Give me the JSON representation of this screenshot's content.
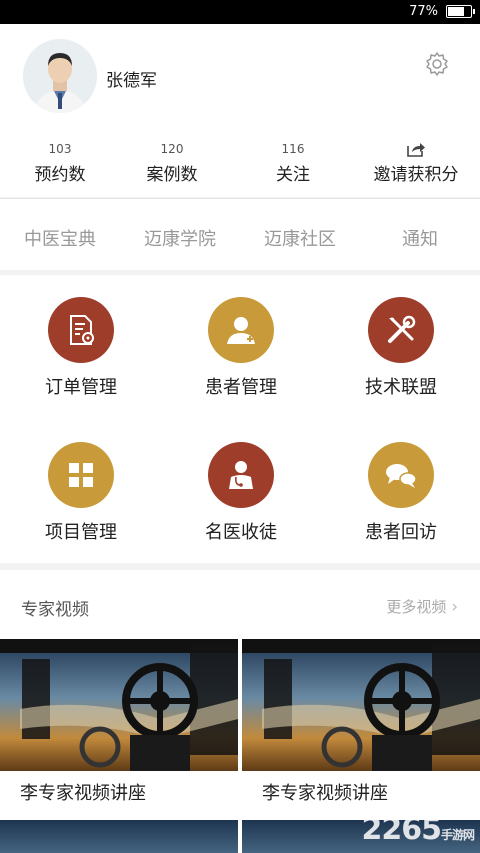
{
  "status_bar": {
    "battery_percent": "77%",
    "battery_level": 0.77
  },
  "profile": {
    "name": "张德军"
  },
  "stats": [
    {
      "count": "103",
      "label": "预约数"
    },
    {
      "count": "120",
      "label": "案例数"
    },
    {
      "count": "116",
      "label": "关注"
    },
    {
      "count": "",
      "label": "邀请获积分"
    }
  ],
  "tabs": [
    "中医宝典",
    "迈康学院",
    "迈康社区",
    "通知"
  ],
  "grid": [
    {
      "label": "订单管理",
      "icon": "document-gear-icon",
      "color": "#9e3d2a"
    },
    {
      "label": "患者管理",
      "icon": "patient-icon",
      "color": "#c89a3a"
    },
    {
      "label": "技术联盟",
      "icon": "tools-icon",
      "color": "#9e3d2a"
    },
    {
      "label": "项目管理",
      "icon": "grid-squares-icon",
      "color": "#c89a3a"
    },
    {
      "label": "名医收徒",
      "icon": "doctor-icon",
      "color": "#9e3d2a"
    },
    {
      "label": "患者回访",
      "icon": "chat-bubbles-icon",
      "color": "#c89a3a"
    }
  ],
  "videos": {
    "section_title": "专家视频",
    "more_label": "更多视频",
    "items": [
      {
        "title": "李专家视频讲座"
      },
      {
        "title": "李专家视频讲座"
      }
    ]
  },
  "watermark": {
    "main": "2265",
    "sub": "手游网"
  }
}
